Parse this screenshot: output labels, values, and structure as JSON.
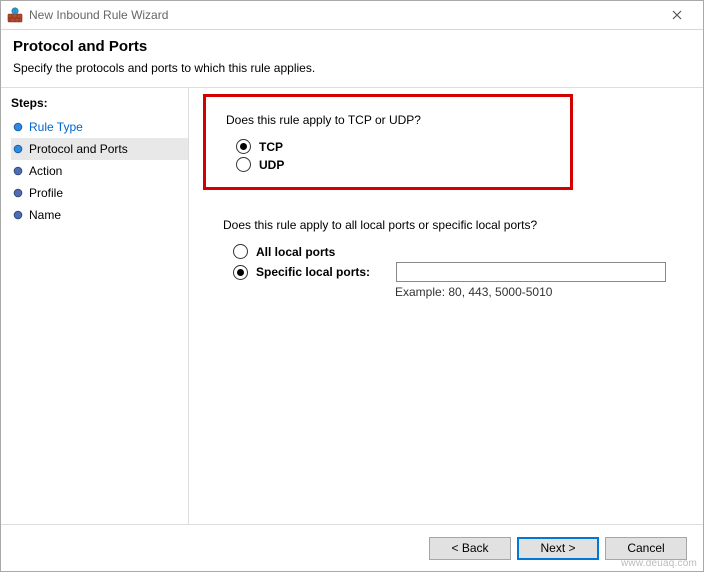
{
  "window": {
    "title": "New Inbound Rule Wizard"
  },
  "header": {
    "title": "Protocol and Ports",
    "subtitle": "Specify the protocols and ports to which this rule applies."
  },
  "sidebar": {
    "heading": "Steps:",
    "items": [
      {
        "label": "Rule Type",
        "state": "done"
      },
      {
        "label": "Protocol and Ports",
        "state": "current"
      },
      {
        "label": "Action",
        "state": "pending"
      },
      {
        "label": "Profile",
        "state": "pending"
      },
      {
        "label": "Name",
        "state": "pending"
      }
    ]
  },
  "content": {
    "protocol": {
      "question": "Does this rule apply to TCP or UDP?",
      "options": {
        "tcp": {
          "label": "TCP",
          "checked": true
        },
        "udp": {
          "label": "UDP",
          "checked": false
        }
      }
    },
    "ports": {
      "question": "Does this rule apply to all local ports or specific local ports?",
      "options": {
        "all": {
          "label": "All local ports",
          "checked": false
        },
        "specific": {
          "label": "Specific local ports:",
          "checked": true
        }
      },
      "input_value": "",
      "example": "Example: 80, 443, 5000-5010"
    }
  },
  "footer": {
    "back": "< Back",
    "next": "Next >",
    "cancel": "Cancel"
  },
  "watermark": "www.deuaq.com"
}
